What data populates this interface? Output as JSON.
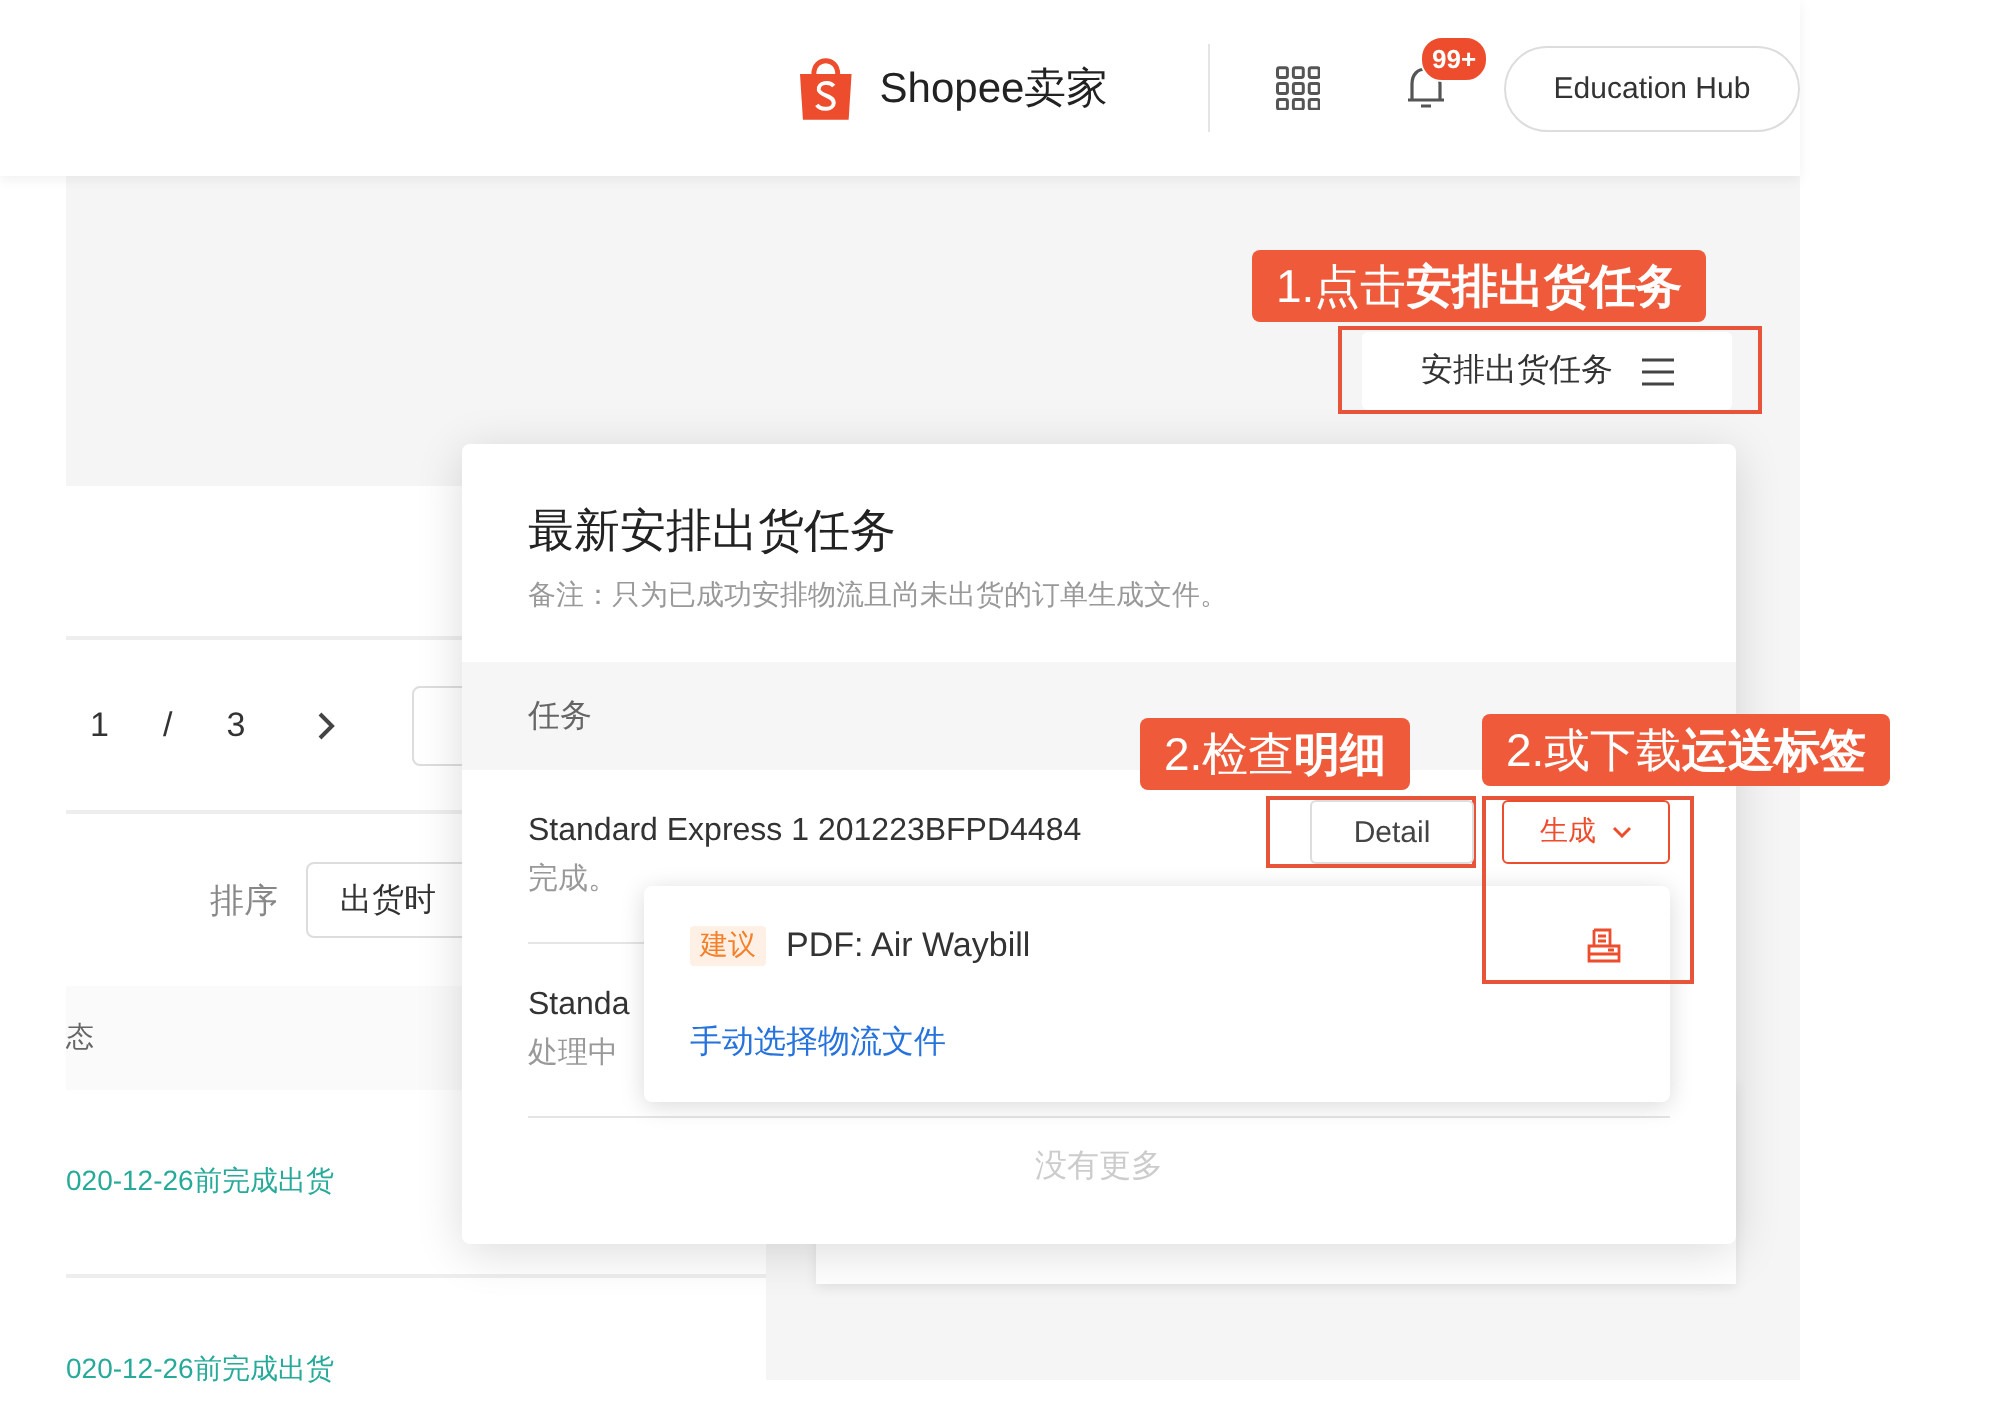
{
  "header": {
    "logo_text": "Shopee卖家",
    "notification_badge": "99+",
    "education_hub": "Education Hub"
  },
  "toolbar": {
    "task_button": "安排出货任务"
  },
  "list_panel": {
    "pagination": {
      "current": "1",
      "separator": "/",
      "total": "3"
    },
    "sort_label": "排序",
    "sort_value": "出货时",
    "columns": [
      "态"
    ],
    "rows": [
      {
        "status": "020-12-26前完成出货"
      },
      {
        "status": "020-12-26前完成出货"
      }
    ]
  },
  "task_popover": {
    "title": "最新安排出货任务",
    "note": "备注：只为已成功安排物流且尚未出货的订单生成文件。",
    "columns": [
      "任务"
    ],
    "tasks": [
      {
        "name": "Standard Express 1 201223BFPD4484",
        "status": "完成。",
        "detail_button": "Detail",
        "generate_button": "生成"
      },
      {
        "name": "Standa",
        "status": "处理中"
      }
    ],
    "footer": "没有更多"
  },
  "generate_menu": {
    "items": [
      {
        "kind": "file",
        "tag": "建议",
        "label": "PDF: Air Waybill"
      },
      {
        "kind": "link",
        "label": "手动选择物流文件"
      }
    ]
  },
  "annotations": [
    {
      "text": "1.点击**安排出货任务**"
    },
    {
      "text": "2.检查**明细**"
    },
    {
      "text": "2.或下载**运送标签**"
    }
  ]
}
